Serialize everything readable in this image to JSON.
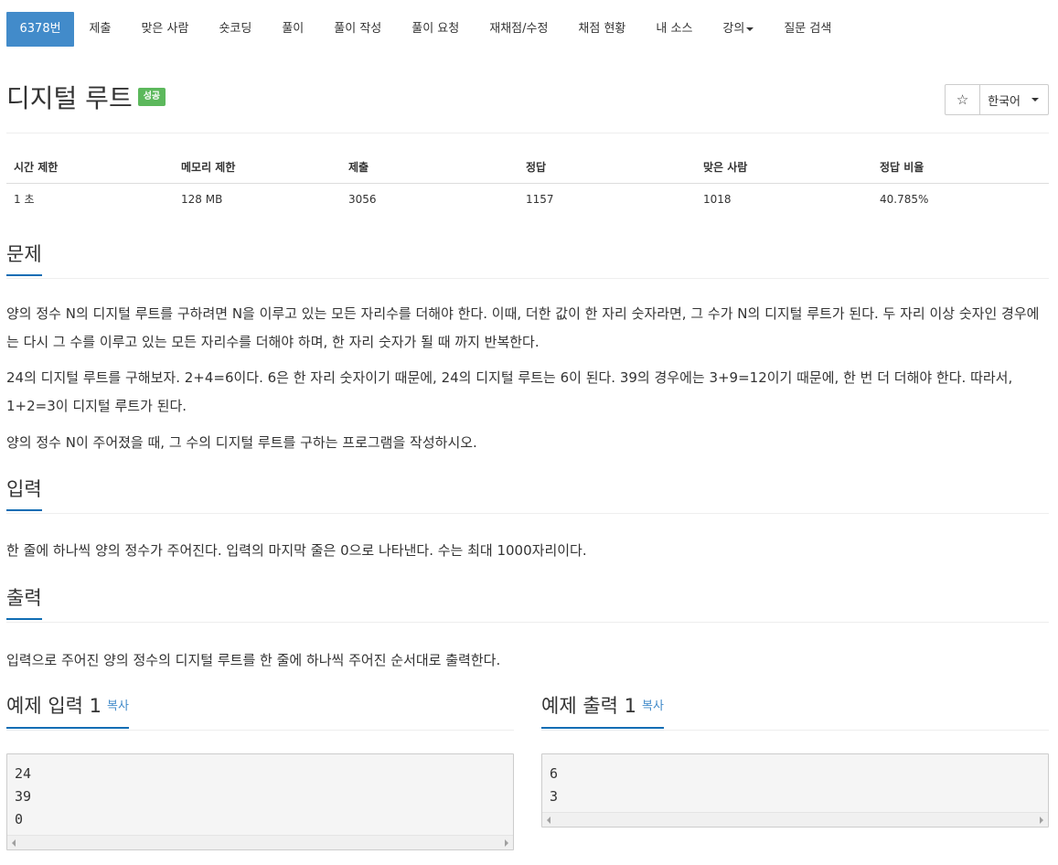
{
  "nav": {
    "items": [
      {
        "label": "6378번",
        "active": true
      },
      {
        "label": "제출"
      },
      {
        "label": "맞은 사람"
      },
      {
        "label": "숏코딩"
      },
      {
        "label": "풀이"
      },
      {
        "label": "풀이 작성"
      },
      {
        "label": "풀이 요청"
      },
      {
        "label": "재채점/수정"
      },
      {
        "label": "채점 현황"
      },
      {
        "label": "내 소스"
      },
      {
        "label": "강의",
        "dropdown": true
      },
      {
        "label": "질문 검색"
      }
    ]
  },
  "problem": {
    "title": "디지털 루트",
    "badge": "성공",
    "star_icon": "star-outline-icon",
    "language": "한국어"
  },
  "stats": {
    "headers": [
      "시간 제한",
      "메모리 제한",
      "제출",
      "정답",
      "맞은 사람",
      "정답 비율"
    ],
    "values": [
      "1 초",
      "128 MB",
      "3056",
      "1157",
      "1018",
      "40.785%"
    ]
  },
  "sections": {
    "problem": {
      "title": "문제",
      "paragraphs": [
        "양의 정수 N의 디지털 루트를 구하려면 N을 이루고 있는 모든 자리수를 더해야 한다. 이때, 더한 값이 한 자리 숫자라면, 그 수가 N의 디지털 루트가 된다. 두 자리 이상 숫자인 경우에는 다시 그 수를 이루고 있는 모든 자리수를 더해야 하며, 한 자리 숫자가 될 때 까지 반복한다.",
        "24의 디지털 루트를 구해보자. 2+4=6이다. 6은 한 자리 숫자이기 때문에, 24의 디지털 루트는 6이 된다. 39의 경우에는 3+9=12이기 때문에, 한 번 더 더해야 한다. 따라서, 1+2=3이 디지털 루트가 된다.",
        "양의 정수 N이 주어졌을 때, 그 수의 디지털 루트를 구하는 프로그램을 작성하시오."
      ]
    },
    "input": {
      "title": "입력",
      "text": "한 줄에 하나씩 양의 정수가 주어진다. 입력의 마지막 줄은 0으로 나타낸다.  수는 최대 1000자리이다."
    },
    "output": {
      "title": "출력",
      "text": "입력으로 주어진 양의 정수의 디지털 루트를 한 줄에 하나씩 주어진 순서대로 출력한다."
    }
  },
  "samples": {
    "input": {
      "title": "예제 입력 1",
      "copy": "복사",
      "content": "24\n39\n0"
    },
    "output": {
      "title": "예제 출력 1",
      "copy": "복사",
      "content": "6\n3"
    }
  }
}
